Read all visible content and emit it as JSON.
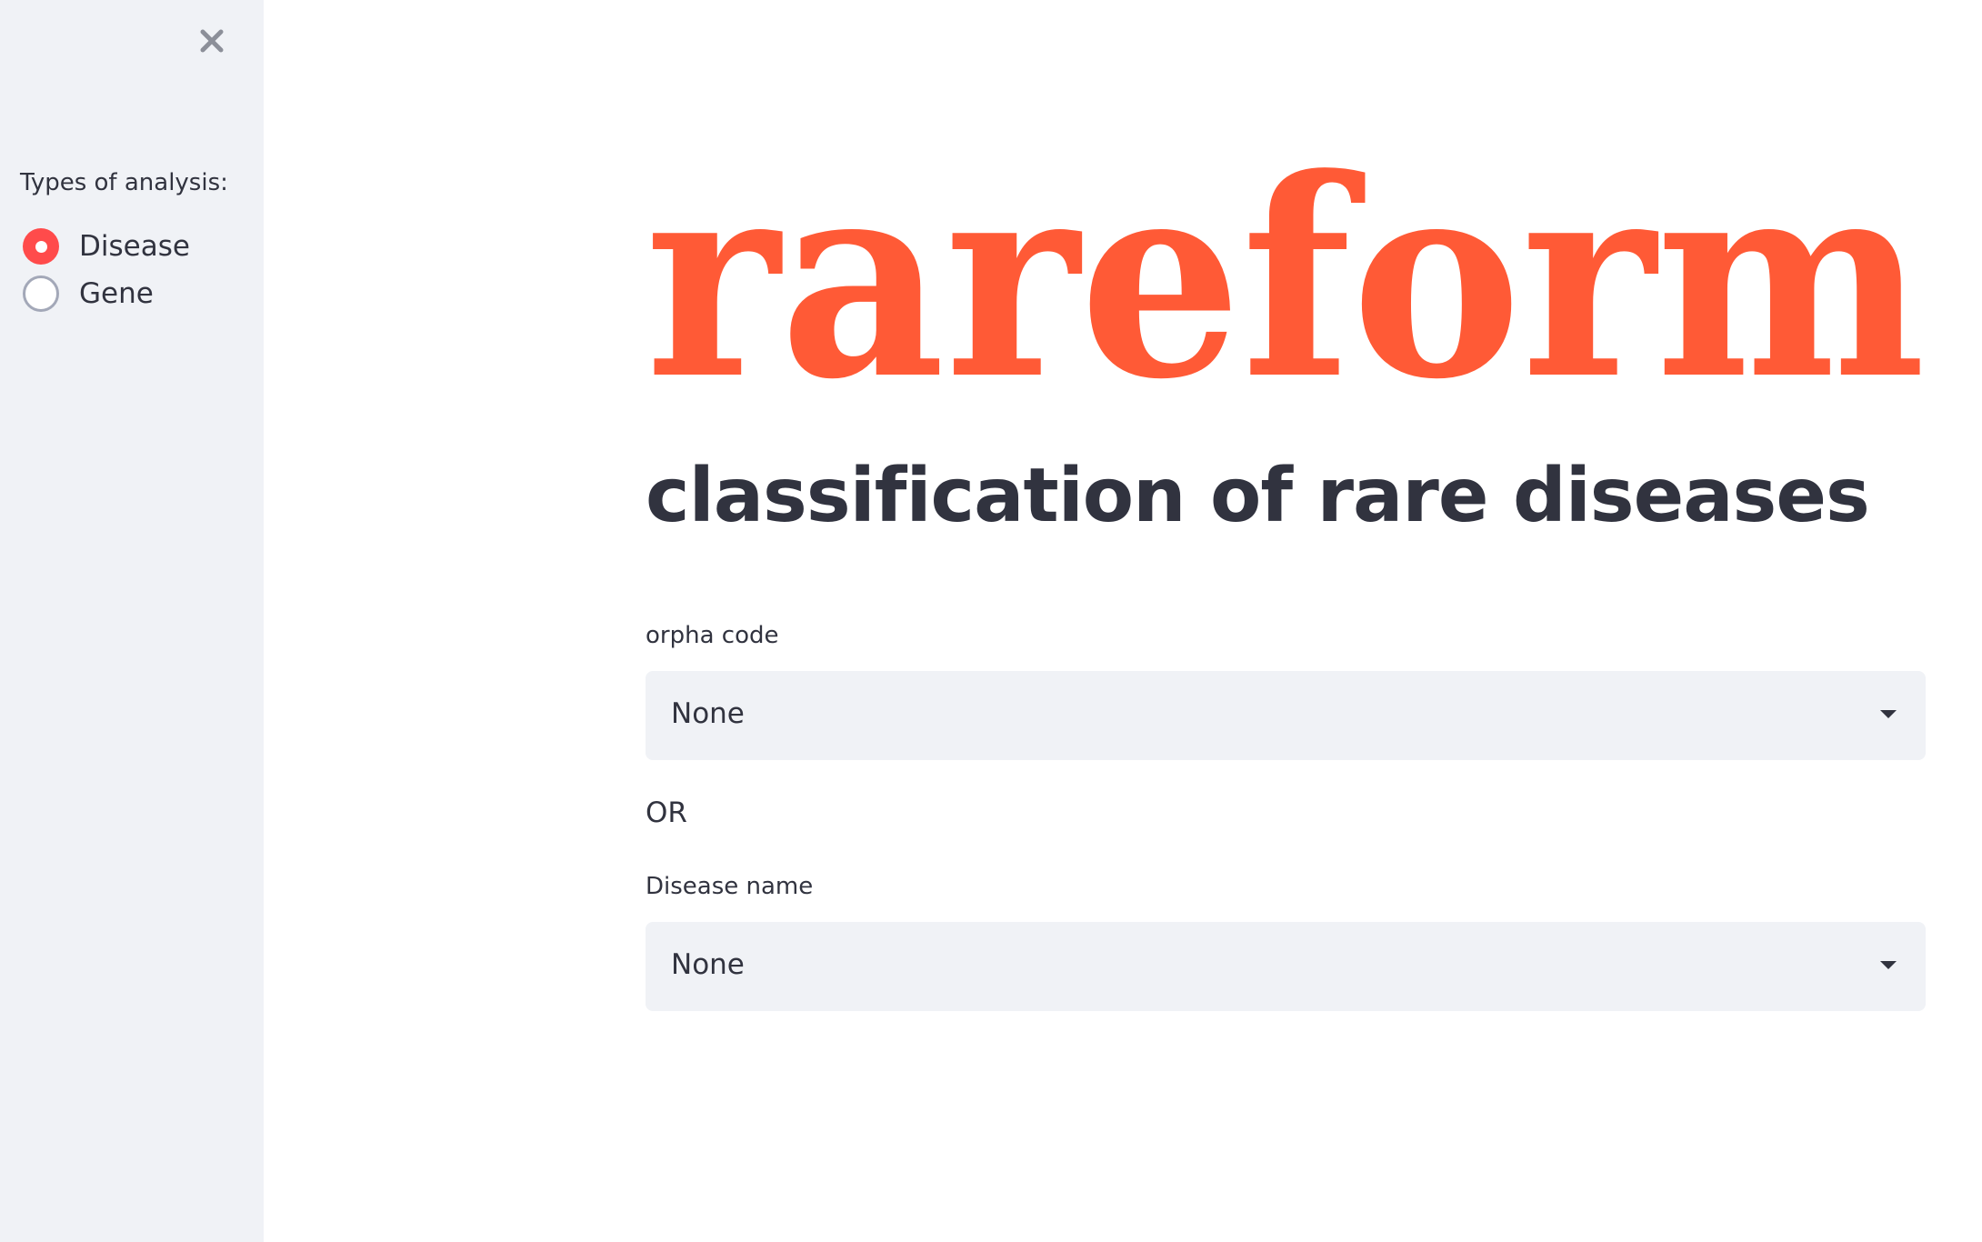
{
  "sidebar": {
    "close_icon": "close-icon",
    "label": "Types of analysis:",
    "options": [
      {
        "label": "Disease",
        "selected": true
      },
      {
        "label": "Gene",
        "selected": false
      }
    ]
  },
  "main": {
    "logo_text": "rareform",
    "logo_color": "#ff5a36",
    "subtitle": "classification of rare diseases",
    "orpha_field": {
      "label": "orpha code",
      "value": "None"
    },
    "or_text": "OR",
    "disease_field": {
      "label": "Disease name",
      "value": "None"
    }
  },
  "colors": {
    "accent": "#ff4b4b",
    "sidebar_bg": "#f0f2f6",
    "text": "#31333f"
  }
}
